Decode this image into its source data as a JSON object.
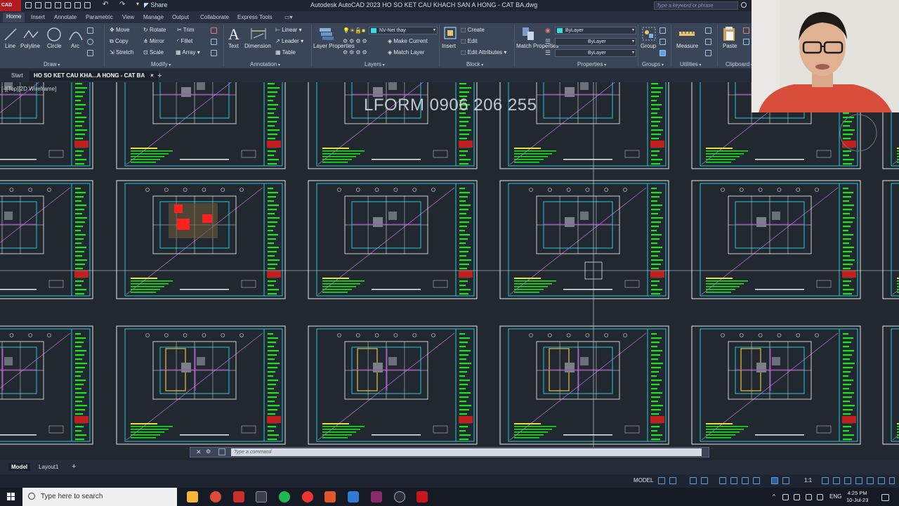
{
  "titlebar": {
    "logo": "CAD",
    "share_label": "Share",
    "title": "Autodesk AutoCAD 2023   HO SO KET CAU KHACH SAN A HONG - CAT BA.dwg",
    "search_placeholder": "Type a keyword or phrase"
  },
  "ribbon_tabs": [
    "Home",
    "Insert",
    "Annotate",
    "Parametric",
    "View",
    "Manage",
    "Output",
    "Collaborate",
    "Express Tools"
  ],
  "draw_panel": {
    "label": "Draw",
    "tools": [
      "Line",
      "Polyline",
      "Circle",
      "Arc"
    ]
  },
  "modify_panel": {
    "label": "Modify",
    "tools": [
      "Move",
      "Rotate",
      "Trim",
      "Copy",
      "Mirror",
      "Fillet",
      "Stretch",
      "Scale",
      "Array"
    ]
  },
  "annotation_panel": {
    "label": "Annotation",
    "tools": [
      "Text",
      "Dimension",
      "Linear",
      "Leader",
      "Table"
    ]
  },
  "layers_panel": {
    "label": "Layers",
    "layer_properties": "Layer Properties",
    "current_layer": "NV-Net thay",
    "make_current": "Make Current",
    "match_layer": "Match Layer"
  },
  "block_panel": {
    "label": "Block",
    "insert": "Insert",
    "tools": [
      "Create",
      "Edit",
      "Edit Attributes"
    ]
  },
  "properties_panel": {
    "label": "Properties",
    "match_properties": "Match Properties",
    "color": "ByLayer",
    "linetype": "ByLayer",
    "lineweight": "ByLayer",
    "color_swatch": "#33e0e0"
  },
  "groups_panel": {
    "label": "Groups",
    "group": "Group"
  },
  "utilities_panel": {
    "label": "Utilities",
    "measure": "Measure"
  },
  "clipboard_panel": {
    "label": "Clipboard",
    "paste": "Paste"
  },
  "file_tabs": {
    "start": "Start",
    "active": "HO SO KET CAU KHA...A HONG - CAT BA",
    "close": "×",
    "add": "+"
  },
  "canvas": {
    "view_label": "[-][Top][2D Wireframe]",
    "watermark": "LFORM 0906 206 255",
    "background": "#212830"
  },
  "command_line": {
    "close": "✕",
    "wrench": "🔧",
    "placeholder": "Type a command"
  },
  "layout_tabs": [
    "Model",
    "Layout1"
  ],
  "layout_add": "+",
  "status_bar": {
    "mode": "MODEL",
    "scale": "1:1"
  },
  "taskbar": {
    "search_placeholder": "Type here to search",
    "language": "ENG",
    "time": "4:25 PM",
    "date": "10-Jul-23"
  }
}
